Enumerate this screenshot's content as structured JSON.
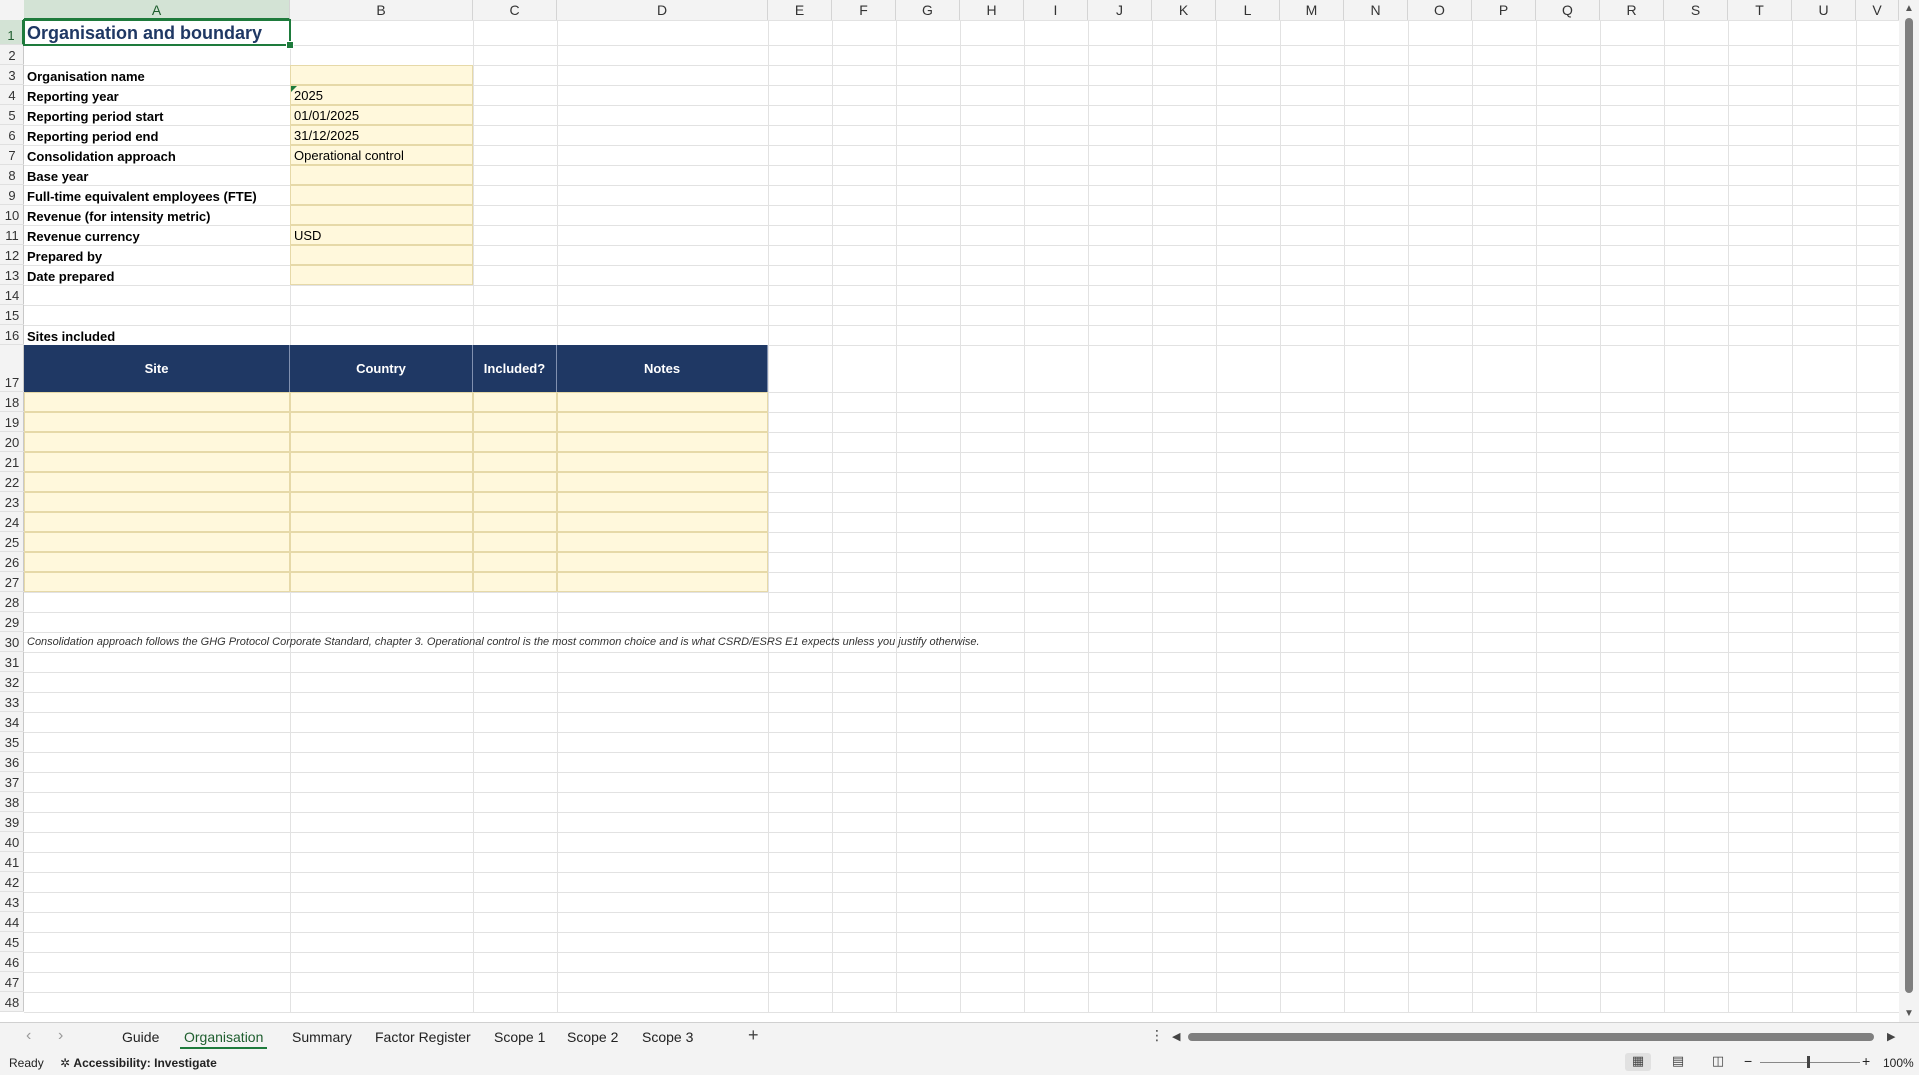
{
  "columns": [
    "A",
    "B",
    "C",
    "D",
    "E",
    "F",
    "G",
    "H",
    "I",
    "J",
    "K",
    "L",
    "M",
    "N",
    "O",
    "P",
    "Q",
    "R",
    "S",
    "T",
    "U",
    "V"
  ],
  "rows": [
    "1",
    "2",
    "3",
    "4",
    "5",
    "6",
    "7",
    "8",
    "9",
    "10",
    "11",
    "12",
    "13",
    "14",
    "15",
    "16",
    "17",
    "18",
    "19",
    "20",
    "21",
    "22",
    "23",
    "24",
    "25",
    "26",
    "27",
    "28",
    "29",
    "30",
    "31",
    "32",
    "33",
    "34",
    "35",
    "36",
    "37",
    "38",
    "39",
    "40",
    "41",
    "42",
    "43",
    "44",
    "45",
    "46",
    "47",
    "48"
  ],
  "sheet": {
    "title": "Organisation and boundary",
    "fields": [
      {
        "label": "Organisation name",
        "value": ""
      },
      {
        "label": "Reporting year",
        "value": "2025"
      },
      {
        "label": "Reporting period start",
        "value": "01/01/2025"
      },
      {
        "label": "Reporting period end",
        "value": "31/12/2025"
      },
      {
        "label": "Consolidation approach",
        "value": "Operational control"
      },
      {
        "label": "Base year",
        "value": ""
      },
      {
        "label": "Full-time equivalent employees (FTE)",
        "value": ""
      },
      {
        "label": "Revenue (for intensity metric)",
        "value": ""
      },
      {
        "label": "Revenue currency",
        "value": "USD"
      },
      {
        "label": "Prepared by",
        "value": ""
      },
      {
        "label": "Date prepared",
        "value": ""
      }
    ],
    "sites_heading": "Sites included",
    "sites_table": {
      "headers": [
        "Site",
        "Country",
        "Included?",
        "Notes"
      ]
    },
    "note": "Consolidation approach follows the GHG Protocol Corporate Standard, chapter 3. Operational control is the most common choice and is what CSRD/ESRS E1 expects unless you justify otherwise."
  },
  "tabs": [
    "Guide",
    "Organisation",
    "Summary",
    "Factor Register",
    "Scope 1",
    "Scope 2",
    "Scope 3"
  ],
  "active_tab": "Organisation",
  "add_tab_label": "+",
  "status": {
    "ready": "Ready",
    "accessibility": "Accessibility: Investigate",
    "zoom": "100%"
  },
  "colors": {
    "header_fill": "#1f3864",
    "input_fill": "#fff8dc",
    "accent": "#1e7b3c"
  }
}
